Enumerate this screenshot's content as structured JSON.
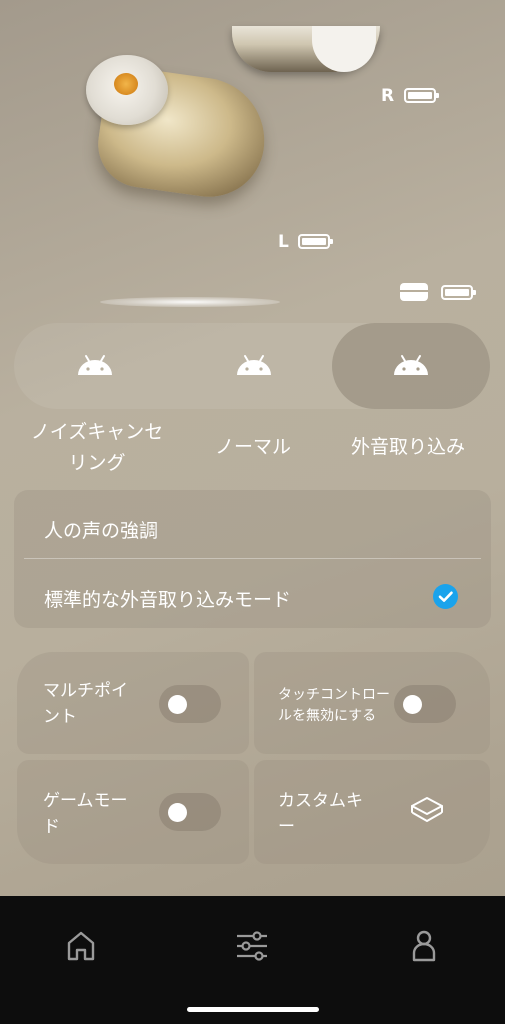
{
  "device": {
    "right_label": "R",
    "left_label": "L",
    "right_battery": 1.0,
    "left_battery": 1.0,
    "case_battery": 1.0
  },
  "modes": {
    "items": [
      {
        "label_line1": "ノイズキャンセ",
        "label_line2": "リング",
        "icon": "android-icon"
      },
      {
        "label_line1": "ノーマル",
        "label_line2": "",
        "icon": "android-icon"
      },
      {
        "label_line1": "外音取り込み",
        "label_line2": "",
        "icon": "android-icon"
      }
    ],
    "selected": "外音取り込み"
  },
  "ambient": {
    "option1": "人の声の強調",
    "option2": "標準的な外音取り込みモード",
    "selected": "標準的な外音取り込みモード"
  },
  "tiles": {
    "multipoint": {
      "line1": "マルチポイ",
      "line2": "ント",
      "on": false
    },
    "touch_disable": {
      "line1": "タッチコントロー",
      "line2": "ルを無効にする",
      "on": false
    },
    "game_mode": {
      "line1": "ゲームモー",
      "line2": "ド",
      "on": false
    },
    "custom_key": {
      "line1": "カスタムキ",
      "line2": "ー",
      "icon": "layers-icon"
    }
  },
  "nav": {
    "items": [
      "home-icon",
      "equalizer-icon",
      "profile-icon"
    ]
  },
  "colors": {
    "accent": "#1aa3ec",
    "nav_bg": "#0d0d0d"
  }
}
